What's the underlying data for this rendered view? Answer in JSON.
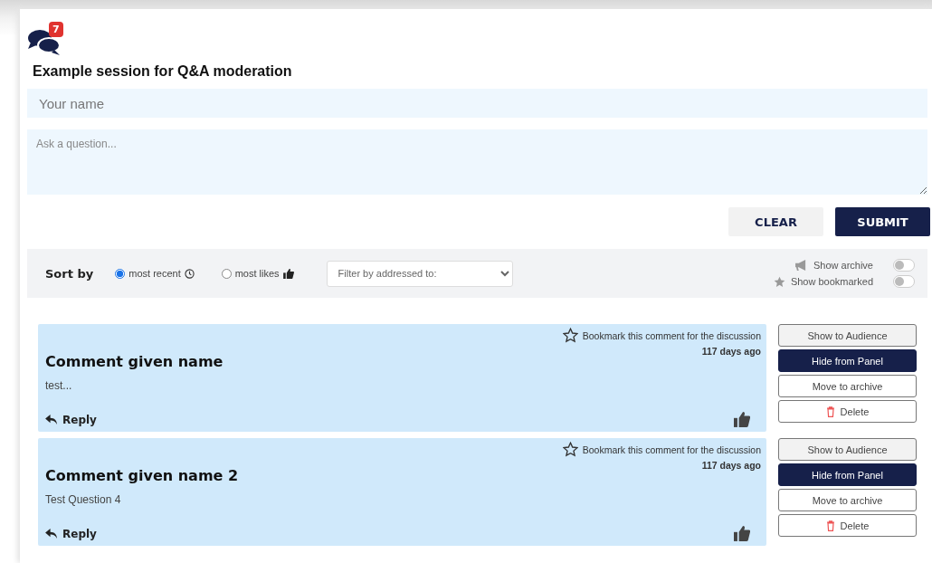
{
  "header": {
    "badge": "7",
    "title": "Example session for Q&A moderation"
  },
  "form": {
    "name_placeholder": "Your name",
    "question_placeholder": "Ask a question...",
    "buttons": [
      {
        "label": "CLEAR",
        "kind": "light"
      },
      {
        "label": "SUBMIT",
        "kind": "dark"
      }
    ]
  },
  "sort_bar": {
    "label": "Sort by",
    "options": [
      {
        "label": "most recent",
        "kind": "clock",
        "selected": true
      },
      {
        "label": "most likes",
        "kind": "thumb",
        "selected": false
      }
    ],
    "filter_placeholder": "Filter by addressed to:",
    "toggles": [
      {
        "label": "Show archive",
        "kind": "megaphone",
        "on": false
      },
      {
        "label": "Show bookmarked",
        "kind": "star",
        "on": false
      }
    ]
  },
  "comments": [
    {
      "name": "Comment given name",
      "text": "test...",
      "bookmark": "Bookmark this comment for the discussion",
      "bookmarked": false,
      "age": "117 days ago",
      "reply": "Reply",
      "actions": [
        {
          "label": "Show to Audience",
          "kind": "light"
        },
        {
          "label": "Hide from Panel",
          "kind": "dark"
        },
        {
          "label": "Move to archive",
          "kind": "outline"
        },
        {
          "label": "Delete",
          "kind": "delete"
        }
      ]
    },
    {
      "name": "Comment given name 2",
      "text": "Test Question 4",
      "bookmark": "Bookmark this comment for the discussion",
      "bookmarked": false,
      "age": "117 days ago",
      "reply": "Reply",
      "actions": [
        {
          "label": "Show to Audience",
          "kind": "light"
        },
        {
          "label": "Hide from Panel",
          "kind": "dark"
        },
        {
          "label": "Move to archive",
          "kind": "outline"
        },
        {
          "label": "Delete",
          "kind": "delete"
        }
      ]
    }
  ]
}
